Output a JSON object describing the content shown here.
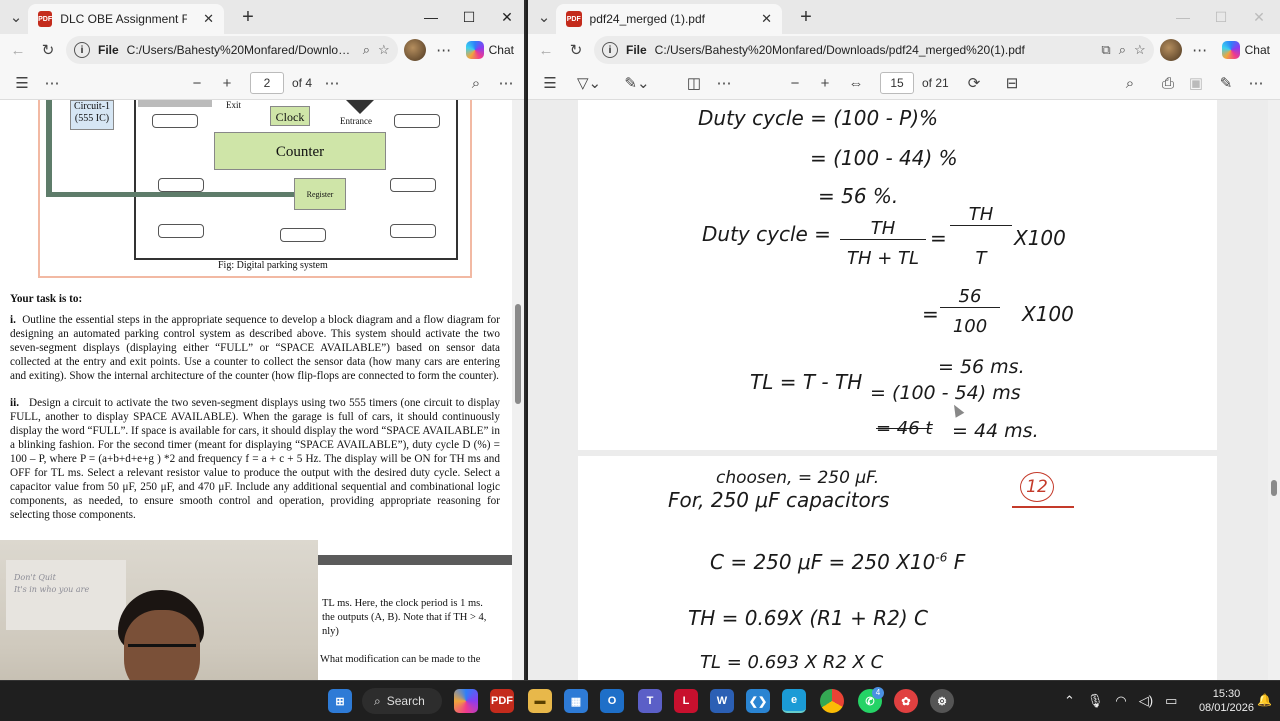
{
  "left_window": {
    "tab_title": "DLC OBE Assignment Fall 25-26 1",
    "address": "C:/Users/Bahesty%20Monfared/Downloads...",
    "file_label": "File",
    "chat_label": "Chat",
    "page_current": "2",
    "page_total": "of 4",
    "figure": {
      "circuit_label_1": "Circuit-1",
      "circuit_label_2": "(555 IC)",
      "exit_label": "Exit",
      "clock_label": "Clock",
      "entrance_label": "Entrance",
      "counter_label": "Counter",
      "register_label": "Register",
      "caption": "Fig: Digital parking system"
    },
    "task_heading": "Your task is to:",
    "para_i_num": "i.",
    "para_i": "Outline the essential steps in the appropriate sequence to develop a block diagram and a flow diagram for designing an automated parking control system as described above. This system should activate the two seven-segment displays (displaying either “FULL” or “SPACE AVAILABLE”) based on sensor data collected at the entry and exit points. Use a counter to collect the sensor data (how many cars are entering and exiting). Show the internal architecture of the counter (how flip-flops are connected to form the counter).",
    "para_ii_num": "ii.",
    "para_ii": "Design a circuit to activate the two seven-segment displays using two 555 timers (one circuit to display FULL, another to display SPACE AVAILABLE). When the garage is full of cars, it should continuously display the word “FULL”. If space is available for cars, it should display the word “SPACE AVAILABLE” in a blinking fashion. For the second timer (meant for displaying “SPACE AVAILABLE”), duty cycle D (%) = 100 – P, where P = (a+b+d+e+g ) *2 and frequency f = a + c + 5 Hz. The display will be ON for TH ms and OFF for TL ms. Select a relevant resistor value to produce the output with the desired duty cycle. Select a capacitor value from 50 μF, 250 μF, and 470 μF. Include any additional sequential and combinational logic components, as needed, to ensure smooth control and operation, providing appropriate reasoning for selecting those components.",
    "next_page_line1": "TL ms. Here, the clock period is 1 ms.",
    "next_page_line2": "the outputs (A, B). Note that if TH > 4,",
    "next_page_line3": "nly)",
    "next_page_line4": "What modification can be made to the"
  },
  "right_window": {
    "tab_title": "pdf24_merged (1).pdf",
    "address": "C:/Users/Bahesty%20Monfared/Downloads/pdf24_merged%20(1).pdf",
    "file_label": "File",
    "chat_label": "Chat",
    "page_current": "15",
    "page_total": "of 21",
    "handwriting_page1": {
      "line1": "Duty cycle = (100 - P)%",
      "line2": "= (100 - 44) %",
      "line3": "= 56 %.",
      "line4a": "Duty cycle =",
      "frac1_num": "TH",
      "frac1_den": "TH + TL",
      "eq2": "=",
      "frac2_num": "TH",
      "frac2_den": "T",
      "x100a": "X100",
      "eq3": "=",
      "frac3_num": "56",
      "frac3_den": "100",
      "x100b": "X100",
      "ms56": "= 56 ms.",
      "tl_line": "TL = T - TH",
      "tl_calc": "= (100 - 54) ms",
      "struck": "= 46 t",
      "result": "= 44 ms."
    },
    "handwriting_page2": {
      "chosen": "choosen, = 250 μF.",
      "for_line": "For, 250 μF capacitors",
      "page_num": "12",
      "c_line": "C = 250 μF = 250 X10",
      "exp": "-6",
      "unit": "F",
      "th_line": "TH = 0.69X (R1 + R2) C",
      "tl_line": "TL = 0.693 X R2 X C"
    }
  },
  "taskbar": {
    "search_label": "Search",
    "time": "15:30",
    "date": "08/01/2026",
    "badge": "4"
  },
  "webcam_note": {
    "line1": "Don't Quit",
    "line2": "It's in who you are"
  },
  "colors": {
    "figure_green": "#cfe5a8",
    "figure_border": "#f2b9a3",
    "page_number_red": "#c43a2a"
  }
}
